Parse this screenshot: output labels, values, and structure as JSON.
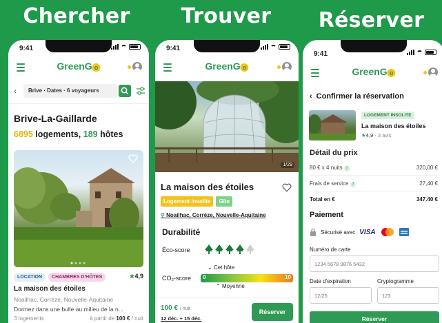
{
  "headings": {
    "search": "Chercher",
    "find": "Trouver",
    "book": "Réserver"
  },
  "status": {
    "time": "9:41"
  },
  "brand": {
    "name": "GreenG",
    "o": "o"
  },
  "screen1": {
    "search_summary": "Brive · Dates · 6 voyageurs",
    "city": "Brive-La-Gaillarde",
    "count_housing": "6895",
    "housing_label": "logements,",
    "count_hosts": "189",
    "hosts_label": "hôtes",
    "tags": [
      "LOCATION",
      "CHAMBRES D'HÔTES"
    ],
    "rating": "4,9",
    "title": "La maison des étoiles",
    "location": "Noailhac, Corrèze, Nouvelle-Aquitaine",
    "desc": "Dormez dans une bulle au milieu de la n...",
    "count": "3 logements",
    "price_prefix": "à partir de",
    "price": "100 €",
    "price_suffix": "/ nuit"
  },
  "screen2": {
    "photo_counter": "1/29",
    "title": "La maison des étoiles",
    "badges": [
      "Logement insolite",
      "Gîte"
    ],
    "location": "Noailhac, Corrèze, Nouvelle-Aquitaine",
    "section": "Durabilité",
    "eco_label": "Éco-score",
    "eco_score": 4,
    "eco_max": 5,
    "this_host": "Cet hôte",
    "co2_label": "CO₂-score",
    "co2_min": "0",
    "co2_max": "10",
    "average": "Moyenne",
    "price": "100 €",
    "per_night": "/ nuit",
    "dates": "12 déc. + 15 déc.",
    "book_btn": "Réserver"
  },
  "screen3": {
    "title": "Confirmer la réservation",
    "badge": "LOGEMENT INSOLITE",
    "name": "La maison des étoiles",
    "rating": "4,9",
    "reviews": "3 avis",
    "price_detail": "Détail du prix",
    "line1_label": "80 € x 4 nuits",
    "line1_value": "320,00 €",
    "line2_label": "Frais de service",
    "line2_value": "27,40 €",
    "total_label": "Total en €",
    "total_value": "347.40 €",
    "payment": "Paiement",
    "secure": "Sécurisé avec",
    "visa": "VISA",
    "card_label": "Numéro de carte",
    "card_placeholder": "1234 5678 9876 5432",
    "exp_label": "Date d'expiration",
    "exp_placeholder": "12/25",
    "cvv_label": "Cryptogramme",
    "cvv_placeholder": "123",
    "book_btn": "Réserver"
  },
  "colors": {
    "brand_green": "#2f9a55",
    "background": "#1f9a4b",
    "accent_yellow": "#f4c21b",
    "pink": "#f7d6ea"
  }
}
